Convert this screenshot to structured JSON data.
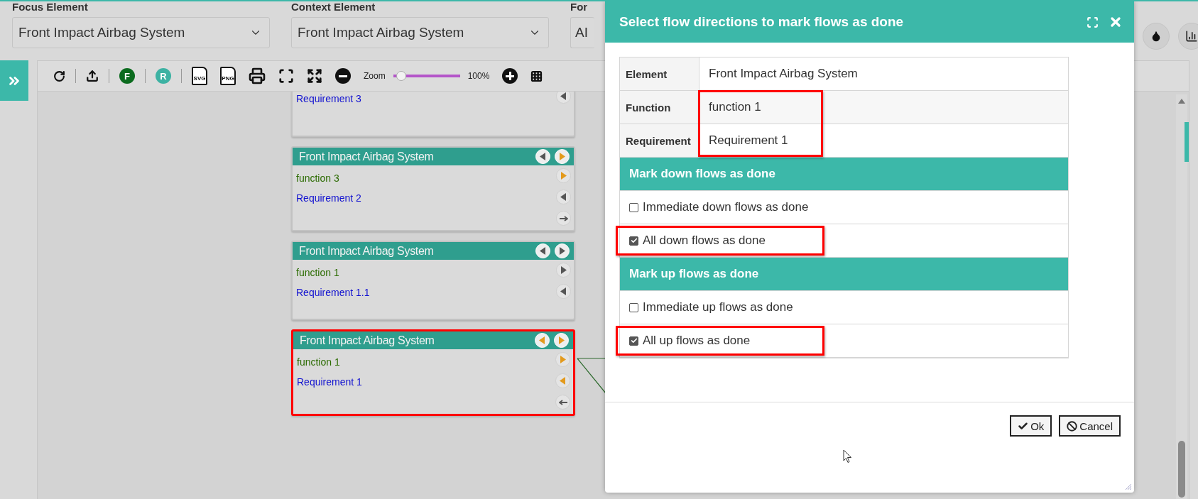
{
  "header": {
    "fields": [
      {
        "label": "Focus Element",
        "value": "Front Impact Airbag System",
        "kind": "dropdown"
      },
      {
        "label": "Context Element",
        "value": "Front Impact Airbag System",
        "kind": "dropdown"
      },
      {
        "label": "For",
        "value": "AI",
        "kind": "partial"
      }
    ],
    "actions": [
      {
        "kind": "droplet"
      },
      {
        "kind": "chart"
      }
    ]
  },
  "toolbar": {
    "items": [
      {
        "kind": "refresh"
      },
      {
        "kind": "separator"
      },
      {
        "kind": "upload"
      },
      {
        "kind": "separator"
      },
      {
        "kind": "letter",
        "text": "F",
        "color": "#0b6b1e"
      },
      {
        "kind": "separator"
      },
      {
        "kind": "letter",
        "text": "R",
        "color": "#3db2a3"
      },
      {
        "kind": "separator"
      },
      {
        "kind": "file",
        "text": "SVG"
      },
      {
        "kind": "file",
        "text": "PNG"
      },
      {
        "kind": "print"
      },
      {
        "kind": "fullscreen"
      },
      {
        "kind": "fit"
      },
      {
        "kind": "zoom-out"
      },
      {
        "kind": "zoom",
        "label": "Zoom",
        "level": 0.12,
        "reading": "100%"
      },
      {
        "kind": "zoom-in"
      },
      {
        "kind": "grid"
      }
    ]
  },
  "nodes": [
    {
      "rows": [
        {
          "kind": "requirement",
          "text": "Requirement 3"
        }
      ],
      "side_buttons": [
        {
          "kind": "left",
          "highlighted": false
        }
      ],
      "selected": false
    },
    {
      "title": "Front Impact Airbag System",
      "rows": [
        {
          "kind": "function",
          "text": "function 3"
        },
        {
          "kind": "requirement",
          "text": "Requirement 2"
        }
      ],
      "header_buttons": [
        {
          "kind": "left",
          "highlighted": false
        },
        {
          "kind": "right",
          "highlighted": true
        }
      ],
      "side_buttons": [
        {
          "kind": "right",
          "highlighted": true
        },
        {
          "kind": "left",
          "highlighted": false
        },
        {
          "kind": "arrow-right",
          "highlighted": false
        }
      ],
      "selected": false
    },
    {
      "title": "Front Impact Airbag System",
      "rows": [
        {
          "kind": "function",
          "text": "function 1"
        },
        {
          "kind": "requirement",
          "text": "Requirement 1.1"
        }
      ],
      "header_buttons": [
        {
          "kind": "left",
          "highlighted": false
        },
        {
          "kind": "right",
          "highlighted": false
        }
      ],
      "side_buttons": [
        {
          "kind": "right",
          "highlighted": false
        },
        {
          "kind": "left",
          "highlighted": false
        }
      ],
      "selected": false
    },
    {
      "title": "Front Impact Airbag System",
      "rows": [
        {
          "kind": "function",
          "text": "function 1"
        },
        {
          "kind": "requirement",
          "text": "Requirement 1"
        }
      ],
      "header_buttons": [
        {
          "kind": "left",
          "highlighted": true
        },
        {
          "kind": "right",
          "highlighted": true
        }
      ],
      "side_buttons": [
        {
          "kind": "right",
          "highlighted": true
        },
        {
          "kind": "left",
          "highlighted": true
        },
        {
          "kind": "arrow-left",
          "highlighted": false
        }
      ],
      "selected": true
    }
  ],
  "dialog": {
    "title": "Select flow directions to mark flows as done",
    "fields": [
      {
        "label": "Element",
        "value": "Front Impact Airbag System",
        "highlighted": false
      },
      {
        "label": "Function",
        "value": "function 1",
        "highlighted": true
      },
      {
        "label": "Requirement",
        "value": "Requirement 1",
        "highlighted": true
      }
    ],
    "sections": [
      {
        "title": "Mark down flows as done",
        "options": [
          {
            "label": "Immediate down flows as done",
            "checked": false,
            "highlighted": false
          },
          {
            "label": "All down flows as done",
            "checked": true,
            "highlighted": true
          }
        ]
      },
      {
        "title": "Mark up flows as done",
        "options": [
          {
            "label": "Immediate up flows as done",
            "checked": false,
            "highlighted": false
          },
          {
            "label": "All up flows as done",
            "checked": true,
            "highlighted": true
          }
        ]
      }
    ],
    "buttons": [
      {
        "kind": "ok",
        "label": "Ok"
      },
      {
        "kind": "cancel",
        "label": "Cancel"
      }
    ]
  }
}
